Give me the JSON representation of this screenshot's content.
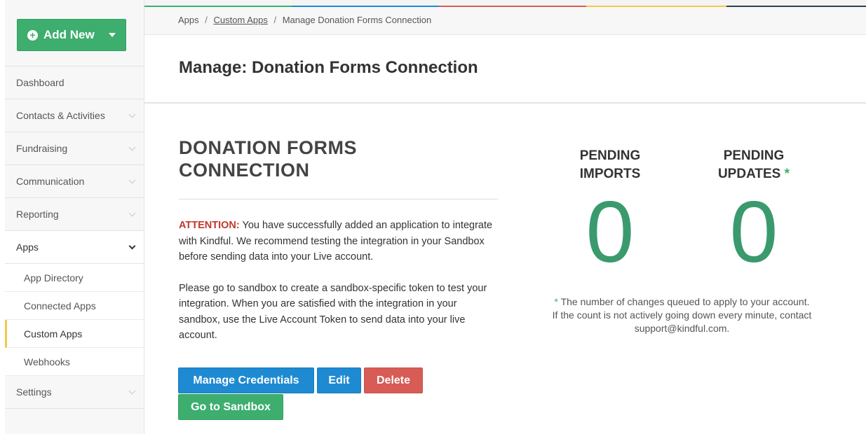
{
  "sidebar": {
    "add_new_label": "Add New",
    "items": [
      {
        "label": "Dashboard"
      },
      {
        "label": "Contacts & Activities"
      },
      {
        "label": "Fundraising"
      },
      {
        "label": "Communication"
      },
      {
        "label": "Reporting"
      },
      {
        "label": "Apps"
      }
    ],
    "apps_subitems": [
      {
        "label": "App Directory"
      },
      {
        "label": "Connected Apps"
      },
      {
        "label": "Custom Apps"
      },
      {
        "label": "Webhooks"
      }
    ],
    "settings_label": "Settings"
  },
  "breadcrumb": {
    "root": "Apps",
    "sep": "/",
    "middle": "Custom Apps",
    "current": "Manage Donation Forms Connection"
  },
  "page": {
    "title": "Manage: Donation Forms Connection"
  },
  "content": {
    "section_title_line1": "DONATION FORMS",
    "section_title_line2": "CONNECTION",
    "attention_label": "ATTENTION:",
    "attention_text": " You have successfully added an application to integrate with Kindful. We recommend testing the integration in your Sandbox before sending data into your Live account.",
    "sandbox_text": "Please go to sandbox to create a sandbox-specific token to test your integration. When you are satisfied with the integration in your sandbox, use the Live Account Token to send data into your live account."
  },
  "buttons": {
    "manage_credentials": "Manage Credentials",
    "edit": "Edit",
    "delete": "Delete",
    "go_to_sandbox": "Go to Sandbox"
  },
  "stats": {
    "imports_line1": "PENDING",
    "imports_line2": "IMPORTS",
    "imports_value": "0",
    "updates_line1": "PENDING",
    "updates_line2": "UPDATES",
    "updates_star": "*",
    "updates_value": "0"
  },
  "note": {
    "star": "*",
    "line1": " The number of changes queued to apply to your account.",
    "line2": "If the count is not actively going down every minute, contact",
    "line3": "support@kindful.com."
  },
  "colors": {
    "accent_green": "#3dae6e",
    "button_blue": "#1e8ad2",
    "button_red": "#d65c55",
    "attention_red": "#c0392b"
  }
}
